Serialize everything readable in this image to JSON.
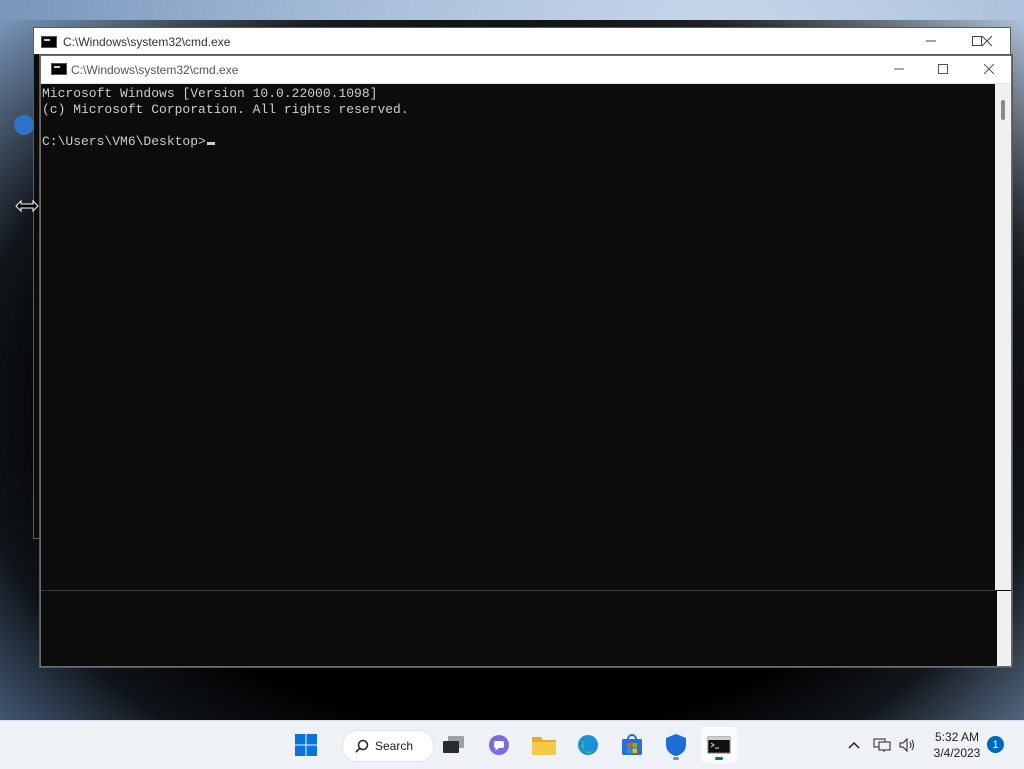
{
  "background_window": {
    "title": "C:\\Windows\\system32\\cmd.exe"
  },
  "window": {
    "title": "C:\\Windows\\system32\\cmd.exe",
    "console_lines": [
      "Microsoft Windows [Version 10.0.22000.1098]",
      "(c) Microsoft Corporation. All rights reserved.",
      "",
      "C:\\Users\\VM6\\Desktop>"
    ]
  },
  "taskbar": {
    "search_label": "Search",
    "time": "5:32 AM",
    "date": "3/4/2023",
    "notification_count": "1"
  },
  "colors": {
    "console_bg": "#0c0c0c",
    "console_text": "#cccccc",
    "accent": "#0067c0"
  }
}
